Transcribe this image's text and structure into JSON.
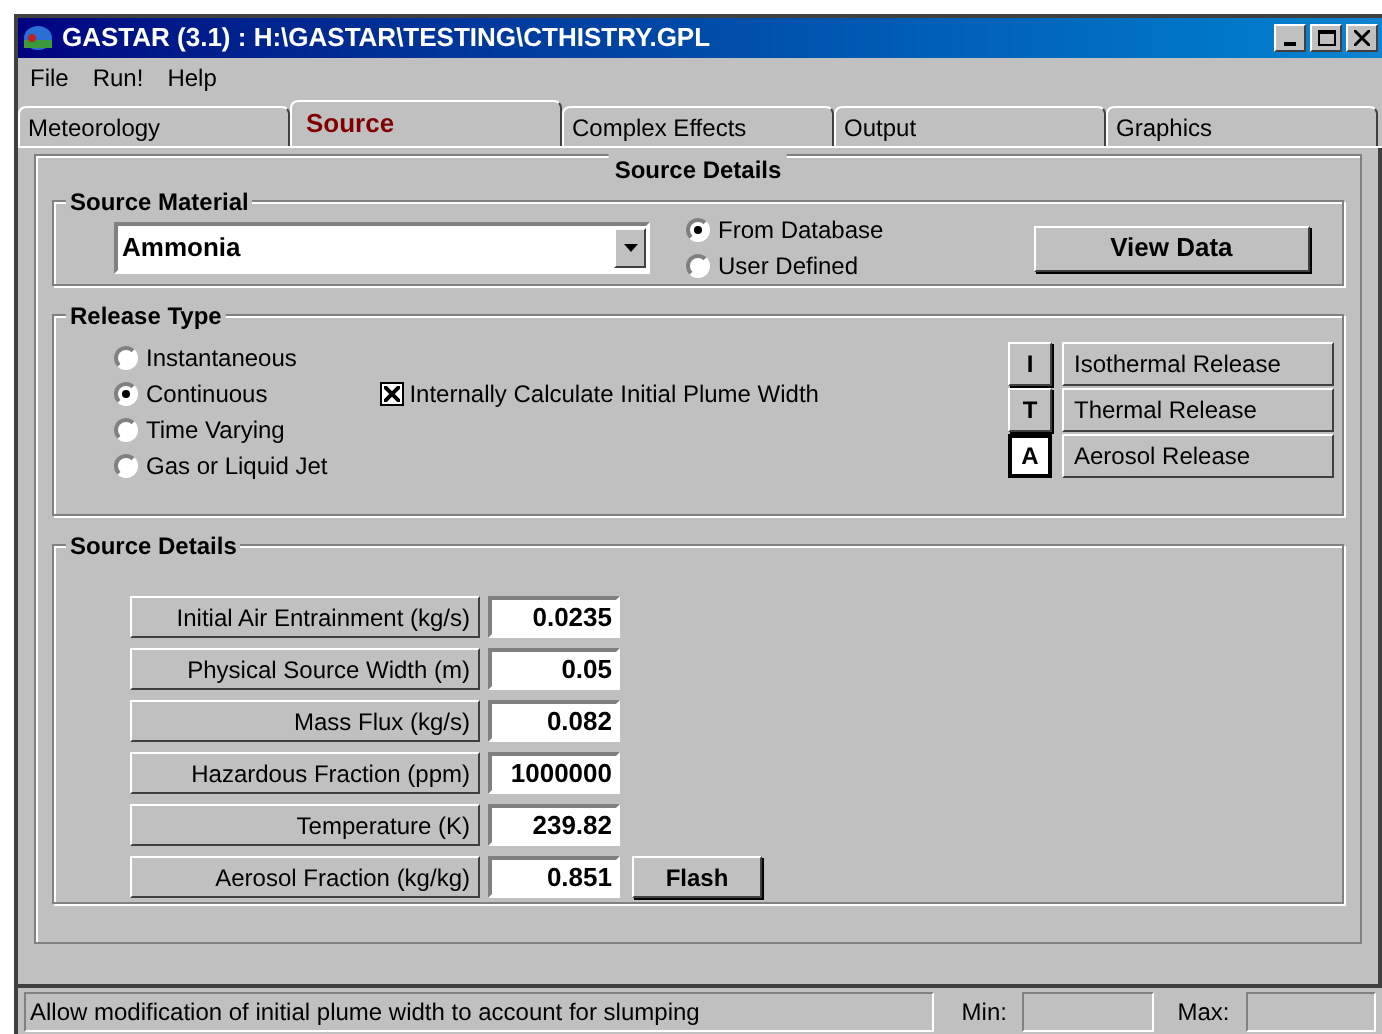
{
  "window": {
    "title": "GASTAR (3.1) : H:\\GASTAR\\TESTING\\CTHISTRY.GPL"
  },
  "menu": [
    "File",
    "Run!",
    "Help"
  ],
  "tabs": [
    {
      "label": "Meteorology",
      "selected": false
    },
    {
      "label": "Source",
      "selected": true
    },
    {
      "label": "Complex Effects",
      "selected": false
    },
    {
      "label": "Output",
      "selected": false
    },
    {
      "label": "Graphics",
      "selected": false
    }
  ],
  "panel_title": "Source Details",
  "source_material": {
    "title": "Source Material",
    "material": "Ammonia",
    "options": [
      {
        "label": "From Database",
        "selected": true
      },
      {
        "label": "User Defined",
        "selected": false
      }
    ],
    "button": "View Data"
  },
  "release_type": {
    "title": "Release Type",
    "options": [
      {
        "label": "Instantaneous",
        "selected": false
      },
      {
        "label": "Continuous",
        "selected": true
      },
      {
        "label": "Time Varying",
        "selected": false
      },
      {
        "label": "Gas or Liquid Jet",
        "selected": false
      }
    ],
    "checkbox": {
      "label": "Internally Calculate Initial Plume Width",
      "checked": true
    },
    "modes": [
      {
        "key": "I",
        "label": "Isothermal Release",
        "selected": false
      },
      {
        "key": "T",
        "label": "Thermal Release",
        "selected": false
      },
      {
        "key": "A",
        "label": "Aerosol Release",
        "selected": true
      }
    ]
  },
  "source_details": {
    "title": "Source Details",
    "fields": [
      {
        "label": "Initial Air Entrainment (kg/s)",
        "value": "0.0235"
      },
      {
        "label": "Physical Source Width (m)",
        "value": "0.05"
      },
      {
        "label": "Mass Flux (kg/s)",
        "value": "0.082"
      },
      {
        "label": "Hazardous Fraction (ppm)",
        "value": "1000000"
      },
      {
        "label": "Temperature (K)",
        "value": "239.82"
      },
      {
        "label": "Aerosol Fraction (kg/kg)",
        "value": "0.851",
        "button": "Flash"
      }
    ]
  },
  "status_bar": {
    "message": "Allow modification of initial plume width to account for slumping",
    "min_label": "Min:",
    "max_label": "Max:"
  }
}
